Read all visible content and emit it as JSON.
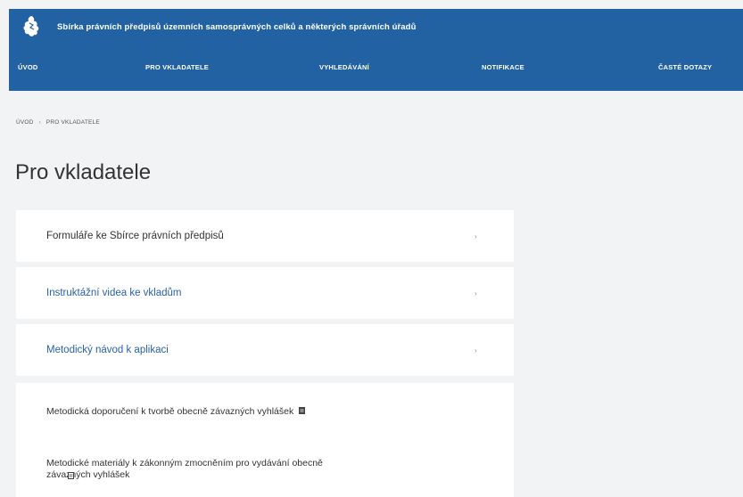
{
  "header": {
    "title": "Sbírka právních předpisů územních samosprávných celků a některých správních úřadů",
    "logo": "czech-lion-icon"
  },
  "nav": {
    "items": [
      {
        "label": "ÚVOD"
      },
      {
        "label": "PRO VKLADATELE"
      },
      {
        "label": "VYHLEDÁVÁNÍ"
      },
      {
        "label": "NOTIFIKACE"
      },
      {
        "label": "ČASTÉ DOTAZY"
      }
    ]
  },
  "breadcrumb": {
    "home": "ÚVOD",
    "separator": "›",
    "current": "PRO VKLADATELE"
  },
  "page": {
    "title": "Pro vkladatele"
  },
  "sections": [
    {
      "label": "Formuláře ke Sbírce právních předpisů",
      "chevron": "›"
    },
    {
      "label": "Instruktážní videa ke vkladům",
      "chevron": "›"
    },
    {
      "label": "Metodický návod k aplikaci",
      "chevron": "›"
    }
  ],
  "documents": [
    {
      "label": "Metodická doporučení k tvorbě obecně závazných vyhlášek"
    },
    {
      "line1": "Metodické materiály k zákonným zmocněním pro vydávání obecně",
      "line2": "závazných vyhlášek"
    }
  ],
  "colors": {
    "header_bg": "#2362a2",
    "page_bg": "#f2f3f5",
    "link_blue": "#2a62a8"
  }
}
